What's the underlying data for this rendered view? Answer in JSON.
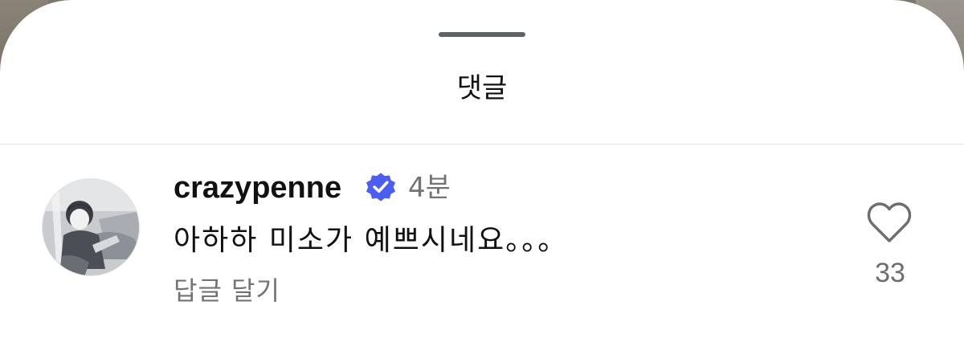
{
  "sheet": {
    "title": "댓글"
  },
  "comment": {
    "username": "crazypenne",
    "verified_icon": "verified-badge-icon",
    "time": "4분",
    "text": "아하하 미소가 예쁘시네요。。。",
    "reply_label": "답글 달기",
    "like_icon": "heart-outline-icon",
    "like_count": "33"
  },
  "colors": {
    "verified": "#4c5df2",
    "muted_text": "#737373",
    "primary_text": "#111111",
    "divider": "#e3e3e3"
  }
}
